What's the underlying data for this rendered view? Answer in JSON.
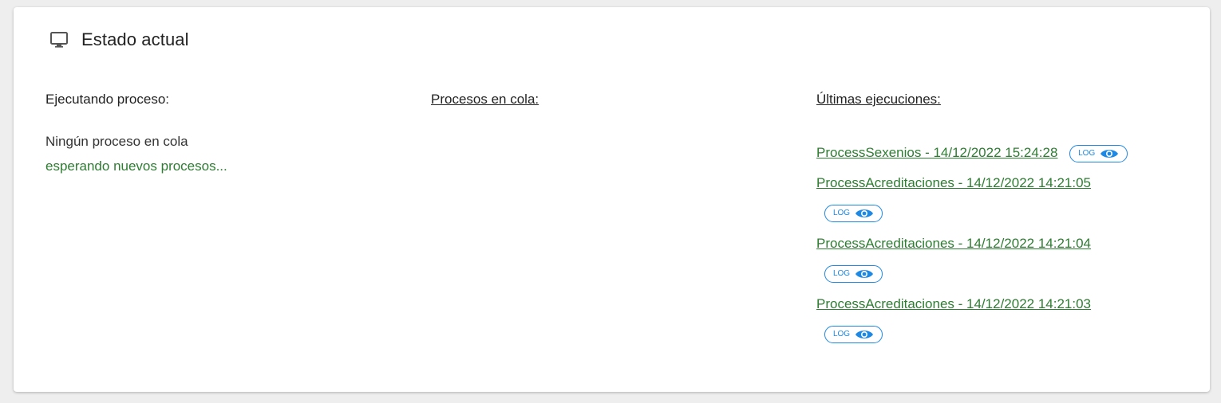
{
  "card": {
    "title": "Estado actual",
    "icon": "monitor-icon"
  },
  "running": {
    "heading": "Ejecutando proceso:",
    "status": "Ningún proceso en cola",
    "waiting": "esperando nuevos procesos..."
  },
  "queue": {
    "heading": "Procesos en cola:"
  },
  "last": {
    "heading": "Últimas ejecuciones:",
    "log_label": "LOG",
    "entries": [
      "ProcessSexenios - 14/12/2022 15:24:28",
      "ProcessAcreditaciones - 14/12/2022 14:21:05",
      "ProcessAcreditaciones - 14/12/2022 14:21:04",
      "ProcessAcreditaciones - 14/12/2022 14:21:03"
    ]
  },
  "colors": {
    "green": "#2e7d32",
    "blue": "#1e88e5"
  }
}
